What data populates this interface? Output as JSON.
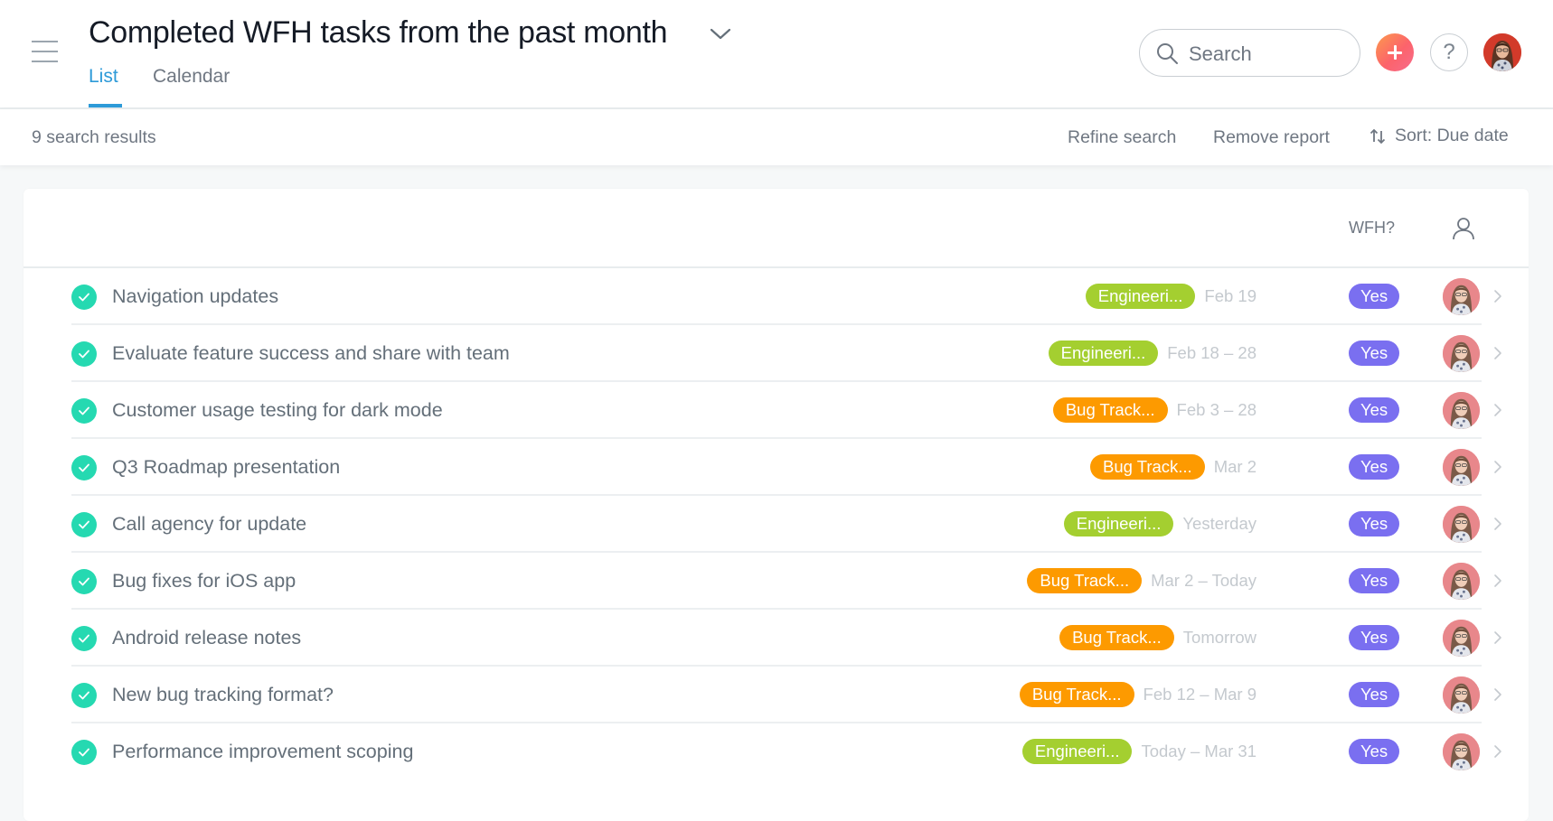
{
  "header": {
    "title": "Completed WFH tasks from the past month",
    "tabs": [
      {
        "label": "List",
        "active": true
      },
      {
        "label": "Calendar",
        "active": false
      }
    ],
    "search": {
      "placeholder": "Search",
      "value": ""
    },
    "add_button_icon": "plus-icon",
    "help_label": "?",
    "accent_color": "#2d9ad8"
  },
  "toolbar": {
    "results_count": "9 search results",
    "refine_label": "Refine search",
    "remove_label": "Remove report",
    "sort_label": "Sort: Due date"
  },
  "table": {
    "columns": {
      "wfh": "WFH?",
      "assignee_icon": "person-icon"
    },
    "colors": {
      "Engineeri...": "#a4cf30",
      "Bug Track...": "#fd9a00",
      "yes_pill": "#7a6ff0",
      "check": "#25d9b1"
    },
    "rows": [
      {
        "name": "Navigation updates",
        "tag": "Engineeri...",
        "date": "Feb 19",
        "wfh": "Yes",
        "completed": true
      },
      {
        "name": "Evaluate feature success and share with team",
        "tag": "Engineeri...",
        "date": "Feb 18 – 28",
        "wfh": "Yes",
        "completed": true
      },
      {
        "name": "Customer usage testing for dark mode",
        "tag": "Bug Track...",
        "date": "Feb 3 – 28",
        "wfh": "Yes",
        "completed": true
      },
      {
        "name": "Q3 Roadmap presentation",
        "tag": "Bug Track...",
        "date": "Mar 2",
        "wfh": "Yes",
        "completed": true
      },
      {
        "name": "Call agency for update",
        "tag": "Engineeri...",
        "date": "Yesterday",
        "wfh": "Yes",
        "completed": true
      },
      {
        "name": "Bug fixes for iOS app",
        "tag": "Bug Track...",
        "date": "Mar 2 – Today",
        "wfh": "Yes",
        "completed": true
      },
      {
        "name": "Android release notes",
        "tag": "Bug Track...",
        "date": "Tomorrow",
        "wfh": "Yes",
        "completed": true
      },
      {
        "name": "New bug tracking format?",
        "tag": "Bug Track...",
        "date": "Feb 12 – Mar 9",
        "wfh": "Yes",
        "completed": true
      },
      {
        "name": "Performance improvement scoping",
        "tag": "Engineeri...",
        "date": "Today – Mar 31",
        "wfh": "Yes",
        "completed": true
      }
    ]
  }
}
